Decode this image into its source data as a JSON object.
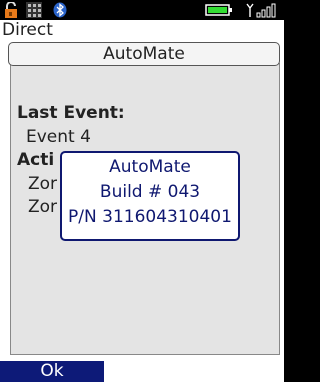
{
  "mode_label": "Direct",
  "app": {
    "title": "AutoMate"
  },
  "panel": {
    "last_event_heading": "Last Event:",
    "last_event_value": "Event 4",
    "active_heading": "Acti",
    "zone_1": "Zor",
    "zone_2": "Zor"
  },
  "popup": {
    "line1": "AutoMate",
    "line2": "Build # 043",
    "line3": "P/N 311604310401"
  },
  "softkeys": {
    "left": "Ok"
  },
  "statusbar": {
    "icons": [
      "lock-icon",
      "keypad-icon",
      "bluetooth-icon",
      "battery-icon",
      "signal-icon"
    ],
    "battery_color": "#33dd33",
    "lock_color": "#e87a1a"
  }
}
